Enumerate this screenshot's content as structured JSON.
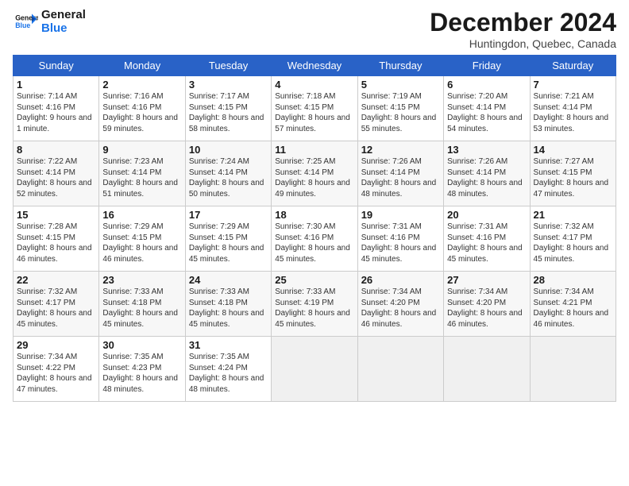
{
  "header": {
    "logo_line1": "General",
    "logo_line2": "Blue",
    "month_title": "December 2024",
    "location": "Huntingdon, Quebec, Canada"
  },
  "days_of_week": [
    "Sunday",
    "Monday",
    "Tuesday",
    "Wednesday",
    "Thursday",
    "Friday",
    "Saturday"
  ],
  "weeks": [
    [
      {
        "day": 1,
        "sunrise": "7:14 AM",
        "sunset": "4:16 PM",
        "daylight": "9 hours and 1 minute."
      },
      {
        "day": 2,
        "sunrise": "7:16 AM",
        "sunset": "4:16 PM",
        "daylight": "8 hours and 59 minutes."
      },
      {
        "day": 3,
        "sunrise": "7:17 AM",
        "sunset": "4:15 PM",
        "daylight": "8 hours and 58 minutes."
      },
      {
        "day": 4,
        "sunrise": "7:18 AM",
        "sunset": "4:15 PM",
        "daylight": "8 hours and 57 minutes."
      },
      {
        "day": 5,
        "sunrise": "7:19 AM",
        "sunset": "4:15 PM",
        "daylight": "8 hours and 55 minutes."
      },
      {
        "day": 6,
        "sunrise": "7:20 AM",
        "sunset": "4:14 PM",
        "daylight": "8 hours and 54 minutes."
      },
      {
        "day": 7,
        "sunrise": "7:21 AM",
        "sunset": "4:14 PM",
        "daylight": "8 hours and 53 minutes."
      }
    ],
    [
      {
        "day": 8,
        "sunrise": "7:22 AM",
        "sunset": "4:14 PM",
        "daylight": "8 hours and 52 minutes."
      },
      {
        "day": 9,
        "sunrise": "7:23 AM",
        "sunset": "4:14 PM",
        "daylight": "8 hours and 51 minutes."
      },
      {
        "day": 10,
        "sunrise": "7:24 AM",
        "sunset": "4:14 PM",
        "daylight": "8 hours and 50 minutes."
      },
      {
        "day": 11,
        "sunrise": "7:25 AM",
        "sunset": "4:14 PM",
        "daylight": "8 hours and 49 minutes."
      },
      {
        "day": 12,
        "sunrise": "7:26 AM",
        "sunset": "4:14 PM",
        "daylight": "8 hours and 48 minutes."
      },
      {
        "day": 13,
        "sunrise": "7:26 AM",
        "sunset": "4:14 PM",
        "daylight": "8 hours and 48 minutes."
      },
      {
        "day": 14,
        "sunrise": "7:27 AM",
        "sunset": "4:15 PM",
        "daylight": "8 hours and 47 minutes."
      }
    ],
    [
      {
        "day": 15,
        "sunrise": "7:28 AM",
        "sunset": "4:15 PM",
        "daylight": "8 hours and 46 minutes."
      },
      {
        "day": 16,
        "sunrise": "7:29 AM",
        "sunset": "4:15 PM",
        "daylight": "8 hours and 46 minutes."
      },
      {
        "day": 17,
        "sunrise": "7:29 AM",
        "sunset": "4:15 PM",
        "daylight": "8 hours and 45 minutes."
      },
      {
        "day": 18,
        "sunrise": "7:30 AM",
        "sunset": "4:16 PM",
        "daylight": "8 hours and 45 minutes."
      },
      {
        "day": 19,
        "sunrise": "7:31 AM",
        "sunset": "4:16 PM",
        "daylight": "8 hours and 45 minutes."
      },
      {
        "day": 20,
        "sunrise": "7:31 AM",
        "sunset": "4:16 PM",
        "daylight": "8 hours and 45 minutes."
      },
      {
        "day": 21,
        "sunrise": "7:32 AM",
        "sunset": "4:17 PM",
        "daylight": "8 hours and 45 minutes."
      }
    ],
    [
      {
        "day": 22,
        "sunrise": "7:32 AM",
        "sunset": "4:17 PM",
        "daylight": "8 hours and 45 minutes."
      },
      {
        "day": 23,
        "sunrise": "7:33 AM",
        "sunset": "4:18 PM",
        "daylight": "8 hours and 45 minutes."
      },
      {
        "day": 24,
        "sunrise": "7:33 AM",
        "sunset": "4:18 PM",
        "daylight": "8 hours and 45 minutes."
      },
      {
        "day": 25,
        "sunrise": "7:33 AM",
        "sunset": "4:19 PM",
        "daylight": "8 hours and 45 minutes."
      },
      {
        "day": 26,
        "sunrise": "7:34 AM",
        "sunset": "4:20 PM",
        "daylight": "8 hours and 46 minutes."
      },
      {
        "day": 27,
        "sunrise": "7:34 AM",
        "sunset": "4:20 PM",
        "daylight": "8 hours and 46 minutes."
      },
      {
        "day": 28,
        "sunrise": "7:34 AM",
        "sunset": "4:21 PM",
        "daylight": "8 hours and 46 minutes."
      }
    ],
    [
      {
        "day": 29,
        "sunrise": "7:34 AM",
        "sunset": "4:22 PM",
        "daylight": "8 hours and 47 minutes."
      },
      {
        "day": 30,
        "sunrise": "7:35 AM",
        "sunset": "4:23 PM",
        "daylight": "8 hours and 48 minutes."
      },
      {
        "day": 31,
        "sunrise": "7:35 AM",
        "sunset": "4:24 PM",
        "daylight": "8 hours and 48 minutes."
      },
      null,
      null,
      null,
      null
    ]
  ]
}
